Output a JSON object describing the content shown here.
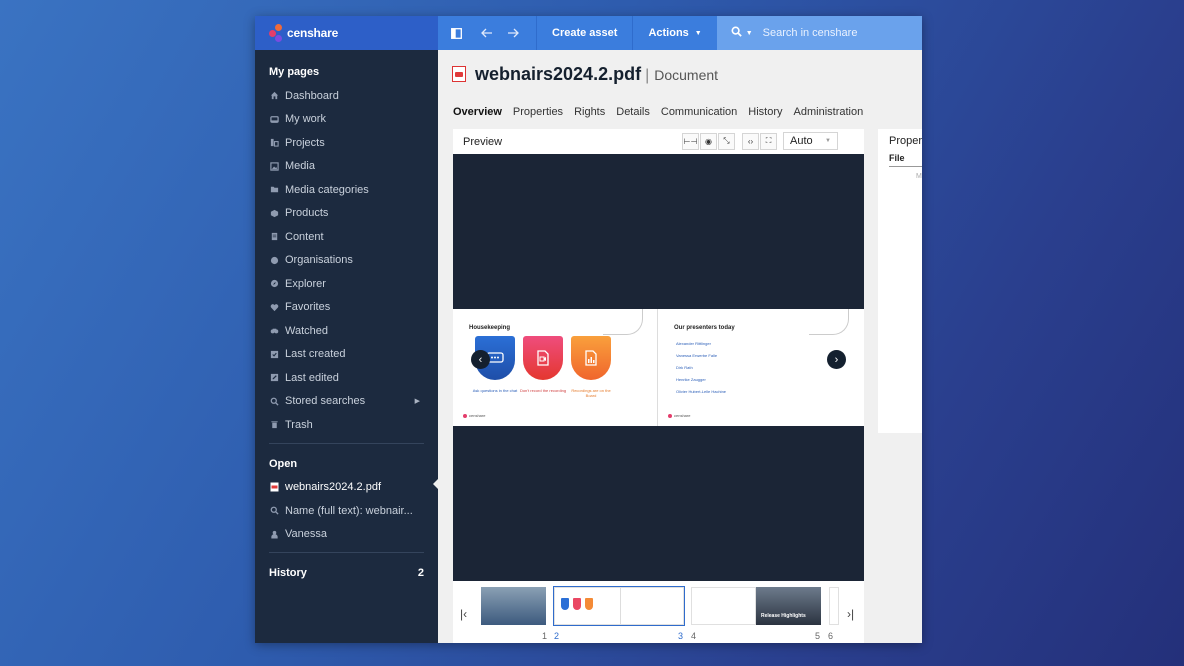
{
  "app": {
    "logo_text": "censhare"
  },
  "sidebar": {
    "my_pages_heading": "My pages",
    "items": [
      {
        "label": "Dashboard",
        "icon": "home-icon"
      },
      {
        "label": "My work",
        "icon": "inbox-icon"
      },
      {
        "label": "Projects",
        "icon": "projects-icon"
      },
      {
        "label": "Media",
        "icon": "image-icon"
      },
      {
        "label": "Media categories",
        "icon": "folder-icon"
      },
      {
        "label": "Products",
        "icon": "cube-icon"
      },
      {
        "label": "Content",
        "icon": "document-icon"
      },
      {
        "label": "Organisations",
        "icon": "globe-icon"
      },
      {
        "label": "Explorer",
        "icon": "compass-icon"
      },
      {
        "label": "Favorites",
        "icon": "heart-icon"
      },
      {
        "label": "Watched",
        "icon": "binoculars-icon"
      },
      {
        "label": "Last created",
        "icon": "checklist-icon"
      },
      {
        "label": "Last edited",
        "icon": "edit-icon"
      },
      {
        "label": "Stored searches",
        "icon": "search-icon",
        "has_submenu": true
      },
      {
        "label": "Trash",
        "icon": "trash-icon"
      }
    ],
    "open_heading": "Open",
    "open_items": [
      {
        "label": "webnairs2024.2.pdf",
        "icon": "pdf-icon",
        "active": true
      },
      {
        "label": "Name (full text): webnair...",
        "icon": "search-icon"
      },
      {
        "label": "Vanessa",
        "icon": "user-icon"
      }
    ],
    "history_heading": "History",
    "history_count": "2"
  },
  "topbar": {
    "create_asset_label": "Create asset",
    "actions_label": "Actions",
    "search_placeholder": "Search in censhare"
  },
  "document": {
    "title": "webnairs2024.2.pdf",
    "separator": "|",
    "type": "Document",
    "tabs": [
      "Overview",
      "Properties",
      "Rights",
      "Details",
      "Communication",
      "History",
      "Administration"
    ],
    "active_tab": "Overview"
  },
  "preview": {
    "heading": "Preview",
    "zoom_select": "Auto",
    "slides": {
      "left_title": "Housekeeping",
      "left_captions": [
        "Ask questions in the chat",
        "Don't record the recording",
        "Recordings are on the Board"
      ],
      "right_title": "Our presenters today",
      "presenters": [
        "Alexander Rittlinger",
        "Vanessa Erwerbe Falle",
        "Dirk Rath",
        "Henrike Zaugger",
        "Olivier Hubert-Lelle Hachine"
      ]
    },
    "thumbnail_pages": [
      "1",
      "2",
      "3",
      "4",
      "5",
      "6"
    ],
    "thumbnail_caption": "Release Highlights"
  },
  "properties": {
    "title": "Proper",
    "tab": "File",
    "letter": "M"
  }
}
